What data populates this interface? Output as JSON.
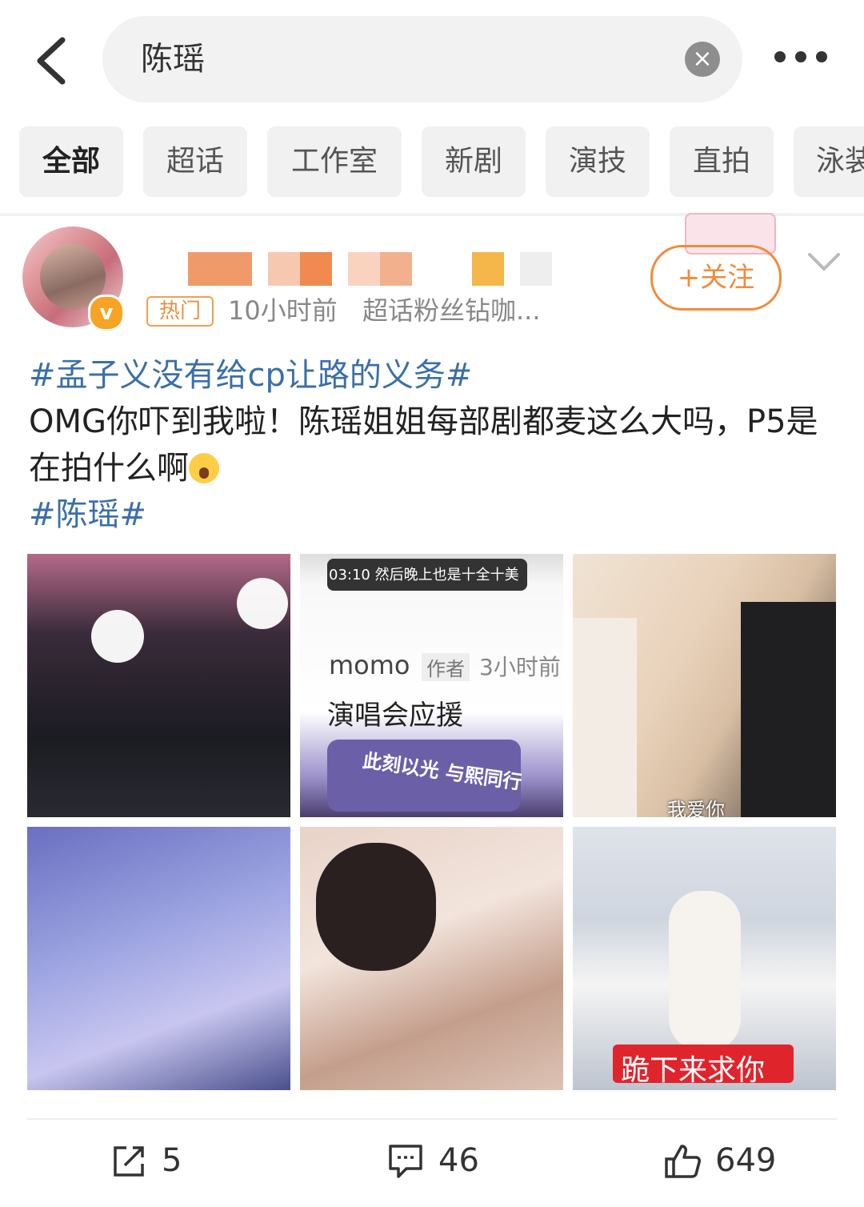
{
  "search": {
    "query": "陈瑶",
    "clear_symbol": "×"
  },
  "tabs": [
    "全部",
    "超话",
    "工作室",
    "新剧",
    "演技",
    "直拍",
    "泳装"
  ],
  "post": {
    "badge": "热门",
    "time": "10小时前",
    "source": "超话粉丝钻咖...",
    "follow_label": "+关注",
    "topic_1": "#孟子义没有给cp让路的义务#",
    "text": "OMG你吓到我啦！陈瑶姐姐每部剧都麦这么大吗，P5是在拍什么啊",
    "topic_2": "#陈瑶#",
    "images": {
      "img2_status": "03:10 然后晚上也是十全十美",
      "img2_user": "momo",
      "img2_author": "作者",
      "img2_time": "3小时前",
      "img2_title": "演唱会应援",
      "img2_banner": "此刻以光 与熙同行",
      "img3_caption": "我爱你",
      "img6_caption": "跪下来求你"
    },
    "actions": {
      "share": "5",
      "comments": "46",
      "likes": "649"
    }
  },
  "colors": {
    "topic": "#3b6fa8",
    "follow": "#f28b3c",
    "hot": "#e98f3a"
  }
}
